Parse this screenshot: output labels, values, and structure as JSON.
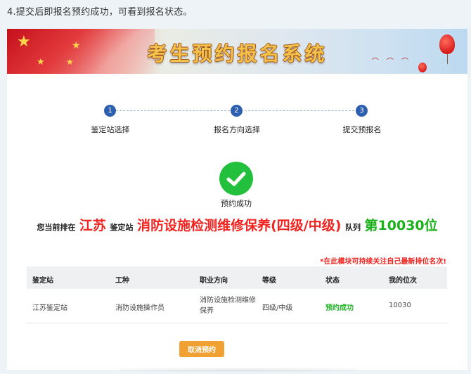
{
  "caption": "4.提交后即报名预约成功，可看到报名状态。",
  "banner": {
    "title": "考生预约报名系统"
  },
  "steps": [
    {
      "num": "1",
      "label": "鉴定站选择"
    },
    {
      "num": "2",
      "label": "报名方向选择"
    },
    {
      "num": "3",
      "label": "提交预报名"
    }
  ],
  "success": {
    "text": "预约成功",
    "icon": "checkmark-icon",
    "color": "#22c03c"
  },
  "queue": {
    "prefix": "您当前排在",
    "province": "江苏",
    "station_word": "鉴定站",
    "course": "消防设施检测维修保养(四级/中级)",
    "queue_word": "队列",
    "rank": "第10030位"
  },
  "note": "*在此模块可持续关注自己最新排位名次!",
  "table": {
    "headers": [
      "鉴定站",
      "工种",
      "职业方向",
      "等级",
      "状态",
      "我的位次"
    ],
    "rows": [
      [
        "江苏鉴定站",
        "消防设施操作员",
        "消防设施检测维修保养",
        "四级/中级",
        "预约成功",
        "10030"
      ]
    ]
  },
  "cancel_button": "取消预约",
  "colors": {
    "accent_red": "#f0231f",
    "accent_green": "#1ab11a",
    "step_blue": "#2d5fb0",
    "button_orange": "#f0a132"
  }
}
